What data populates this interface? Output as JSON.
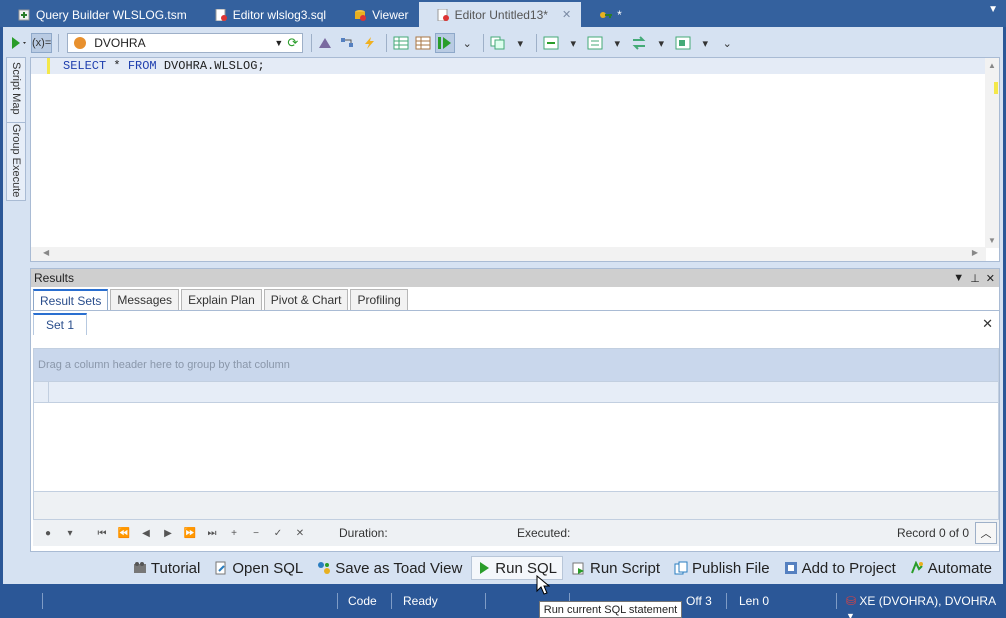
{
  "tabs": [
    {
      "label": "Query Builder WLSLOG.tsm",
      "icon": "query-builder-icon",
      "active": false
    },
    {
      "label": "Editor wlslog3.sql",
      "icon": "sql-file-icon",
      "active": false
    },
    {
      "label": "Viewer",
      "icon": "database-viewer-icon",
      "active": false
    },
    {
      "label": "Editor Untitled13*",
      "icon": "sql-file-icon",
      "active": true,
      "close": "✕"
    },
    {
      "label": "*",
      "icon": "key-icon",
      "active": false
    }
  ],
  "toolbar": {
    "connection": "DVOHRA"
  },
  "side_tabs": [
    "Script Map",
    "Group Execute"
  ],
  "editor": {
    "code_kw1": "SELECT",
    "code_op": " * ",
    "code_kw2": "FROM",
    "code_rest": " DVOHRA.WLSLOG;"
  },
  "results": {
    "title": "Results",
    "tabs": [
      "Result Sets",
      "Messages",
      "Explain Plan",
      "Pivot & Chart",
      "Profiling"
    ],
    "set_tab": "Set 1",
    "group_hint": "Drag a column header here to group by that column",
    "duration_label": "Duration:",
    "executed_label": "Executed:",
    "record_label": "Record 0 of 0"
  },
  "actions": [
    "Tutorial",
    "Open SQL",
    "Save as Toad View",
    "Run SQL",
    "Run Script",
    "Publish File",
    "Add to Project",
    "Automate"
  ],
  "status": {
    "code": "Code",
    "ready": "Ready",
    "off": "Off 3",
    "len": "Len 0",
    "conn": "XE (DVOHRA), DVOHRA"
  },
  "tooltip": "Run current SQL statement",
  "colors": {
    "titlebar": "#2b5797",
    "panel": "#d6e2f2",
    "keyword": "#1f3fae"
  }
}
